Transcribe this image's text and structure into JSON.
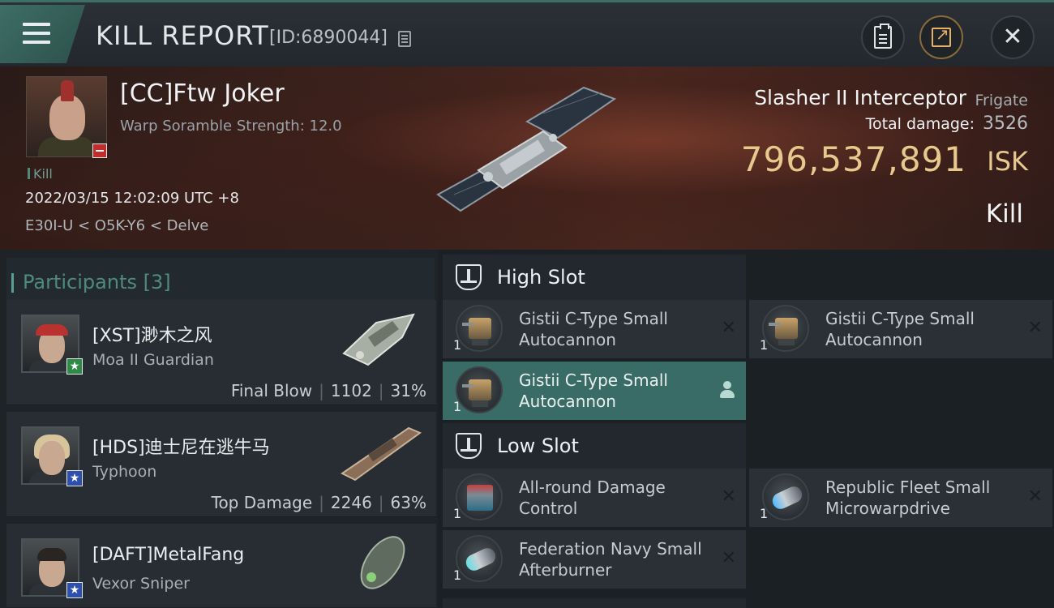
{
  "header": {
    "title": "KILL REPORT",
    "report_id": "[ID:6890044]"
  },
  "victim": {
    "name": "[CC]Ftw Joker",
    "scramble": "Warp Soramble Strength: 12.0",
    "tag": "Kill",
    "datetime": "2022/03/15 12:02:09 UTC +8",
    "location": "E30I-U < O5K-Y6 < Delve",
    "ship_name": "Slasher II Interceptor",
    "ship_class": "Frigate",
    "damage_label": "Total damage:",
    "damage_value": "3526",
    "isk_value": "796,537,891",
    "isk_unit": "ISK",
    "result": "Kill"
  },
  "participants": {
    "title": "Participants [3]",
    "items": [
      {
        "name": "[XST]渺木之风",
        "ship": "Moa II Guardian",
        "label": "Final Blow",
        "damage": "1102",
        "percent": "31%",
        "badge": "★"
      },
      {
        "name": "[HDS]迪士尼在逃牛马",
        "ship": "Typhoon",
        "label": "Top Damage",
        "damage": "2246",
        "percent": "63%",
        "badge": "★"
      },
      {
        "name": "[DAFT]MetalFang",
        "ship": "Vexor Sniper",
        "badge": "★"
      }
    ]
  },
  "fitting": {
    "high_slot": {
      "title": "High Slot",
      "items": [
        {
          "qty": "1",
          "name": "Gistii C-Type Small Autocannon"
        },
        {
          "qty": "1",
          "name": "Gistii C-Type Small Autocannon"
        },
        {
          "qty": "1",
          "name": "Gistii C-Type Small Autocannon"
        }
      ]
    },
    "low_slot": {
      "title": "Low Slot",
      "items": [
        {
          "qty": "1",
          "name": "All-round Damage Control"
        },
        {
          "qty": "1",
          "name": "Republic Fleet Small Microwarpdrive"
        },
        {
          "qty": "1",
          "name": "Federation Navy Small Afterburner"
        }
      ]
    }
  },
  "colors": {
    "accent": "#3e6e66",
    "isk": "#e7c98e",
    "highlight": "#3a6c67"
  }
}
